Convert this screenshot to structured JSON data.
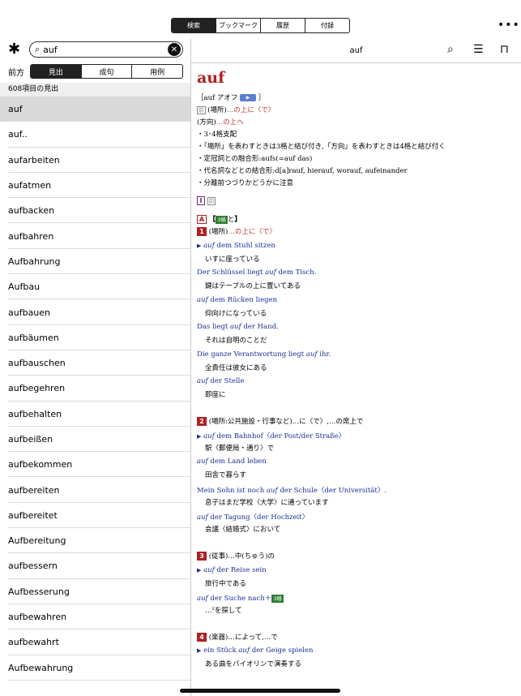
{
  "top_tabs": [
    "検索",
    "ブックマーク",
    "履歴",
    "付録"
  ],
  "more_icon": "ellipsis-icon",
  "left": {
    "search_value": "auf",
    "mode_label": "前方",
    "sub_tabs": [
      "見出",
      "成句",
      "用例"
    ],
    "count": "608項目の見出",
    "items": [
      "auf",
      "auf..",
      "aufarbeiten",
      "aufatmen",
      "aufbacken",
      "aufbahren",
      "Aufbahrung",
      "Aufbau",
      "aufbauen",
      "aufbäumen",
      "aufbauschen",
      "aufbegehren",
      "aufbehalten",
      "aufbeißen",
      "aufbekommen",
      "aufbereiten",
      "aufbereitet",
      "Aufbereitung",
      "aufbessern",
      "Aufbesserung",
      "aufbewahren",
      "aufbewahrt",
      "Aufbewahrung"
    ]
  },
  "right": {
    "title": "auf",
    "headword": "auf",
    "pron": "［auf アオフ",
    "pron_end": "］",
    "play_icon": "▶",
    "tag_ki": "前",
    "def1a": "(場所)",
    "def1b": "…の上に〈で〉",
    "def2a": "(方向)",
    "def2b": "…の上へ",
    "notes": [
      "・3･4格支配",
      "・「場所」を表わすときは3格と結び付き,「方向」を表わすときは4格と結び付く",
      "・定冠詞との融合形:aufs(=auf das)",
      "・代名詞などとの結合形:d[a]rauf, hierauf, worauf, aufeinander",
      "・分離前つづりかどうかに注意"
    ],
    "roman_I": "I",
    "A_label": "A",
    "A_case": "3格",
    "A_after": "と",
    "s1_num": "1",
    "s1_a": "(場所)",
    "s1_b": "…の上に〈で〉",
    "ex1": [
      {
        "de_pre": "",
        "de_em": "auf",
        "de_post": " dem Stuhl sitzen",
        "ja": "いすに座っている"
      },
      {
        "de_pre": "Der Schlüssel liegt ",
        "de_em": "auf",
        "de_post": " dem Tisch.",
        "ja": "鍵はテーブルの上に置いてある"
      },
      {
        "de_pre": "",
        "de_em": "auf",
        "de_post": " dem Rücken liegen",
        "ja": "仰向けになっている"
      },
      {
        "de_pre": "Das liegt ",
        "de_em": "auf",
        "de_post": " der Hand.",
        "ja": "それは自明のことだ"
      },
      {
        "de_pre": "Die ganze Verantwortung liegt ",
        "de_em": "auf",
        "de_post": " ihr.",
        "ja": "全責任は彼女にある"
      },
      {
        "de_pre": "",
        "de_em": "auf",
        "de_post": " der Stelle",
        "ja": "即座に"
      }
    ],
    "s2_num": "2",
    "s2_text": "(場所:公共施設・行事など)…に〈で〉,…の席上で",
    "ex2": [
      {
        "de_pre": "",
        "de_em": "auf",
        "de_post": " dem Bahnhof〈der Post/der Straße〉",
        "ja": "駅〈郵便局・通り〉で"
      },
      {
        "de_pre": "",
        "de_em": "auf",
        "de_post": " dem Land leben",
        "ja": "田舎で暮らす"
      },
      {
        "de_pre": "Mein Sohn ist noch ",
        "de_em": "auf",
        "de_post": " der Schule〈der Universität〉.",
        "ja": "息子はまだ学校〈大学〉に通っています"
      },
      {
        "de_pre": "",
        "de_em": "auf",
        "de_post": " der Tagung〈der Hochzeit〉",
        "ja": "会議〈結婚式〉において"
      }
    ],
    "s3_num": "3",
    "s3_text": "(従事)…中(ちゅう)の",
    "ex3": [
      {
        "de_pre": "",
        "de_em": "auf",
        "de_post": " der Reise sein",
        "ja": "旅行中である"
      },
      {
        "de_pre": "",
        "de_em": "auf",
        "de_post": " der Suche nach＋",
        "ja": "…²を探して",
        "badge": "3格"
      }
    ],
    "s4_num": "4",
    "s4_text": "(楽器)…によって,…で",
    "ex4": [
      {
        "de_pre": "ein Stück ",
        "de_em": "auf",
        "de_post": " der Geige spielen",
        "ja": "ある曲をバイオリンで演奏する"
      }
    ]
  }
}
